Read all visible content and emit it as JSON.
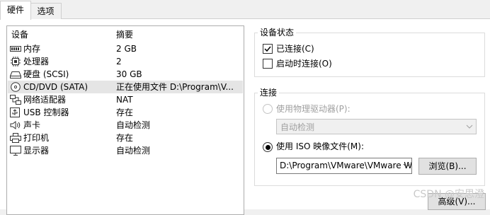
{
  "tabs": [
    {
      "label": "硬件",
      "active": true
    },
    {
      "label": "选项",
      "active": false
    }
  ],
  "device_list": {
    "col_device": "设备",
    "col_summary": "摘要",
    "rows": [
      {
        "icon": "memory-icon",
        "name": "内存",
        "summary": "2 GB"
      },
      {
        "icon": "processor-icon",
        "name": "处理器",
        "summary": "2"
      },
      {
        "icon": "hard-disk-icon",
        "name": "硬盘 (SCSI)",
        "summary": "30 GB"
      },
      {
        "icon": "cd-dvd-icon",
        "name": "CD/DVD (SATA)",
        "summary": "正在使用文件 D:\\Program\\V...",
        "selected": true
      },
      {
        "icon": "network-adapter-icon",
        "name": "网络适配器",
        "summary": "NAT"
      },
      {
        "icon": "usb-icon",
        "name": "USB 控制器",
        "summary": "存在"
      },
      {
        "icon": "sound-card-icon",
        "name": "声卡",
        "summary": "自动检测"
      },
      {
        "icon": "printer-icon",
        "name": "打印机",
        "summary": "存在"
      },
      {
        "icon": "display-icon",
        "name": "显示器",
        "summary": "自动检测"
      }
    ]
  },
  "device_status": {
    "title": "设备状态",
    "connected": {
      "label": "已连接(C)",
      "checked": true
    },
    "connect_at_power_on": {
      "label": "启动时连接(O)",
      "checked": false
    }
  },
  "connection": {
    "title": "连接",
    "physical_drive": {
      "label": "使用物理驱动器(P):",
      "selected": false,
      "disabled": true
    },
    "physical_drive_value": "自动检测",
    "iso_image": {
      "label": "使用 ISO 映像文件(M):",
      "selected": true
    },
    "iso_path": "D:\\Program\\VMware\\VMware W",
    "browse_label": "浏览(B)..."
  },
  "advanced_label": "高级(V)...",
  "watermark": "CSDN @安思澄",
  "colors": {
    "selected_row": "#e5e5e5",
    "disabled_text": "#a0a0a0",
    "border": "#adadad"
  }
}
